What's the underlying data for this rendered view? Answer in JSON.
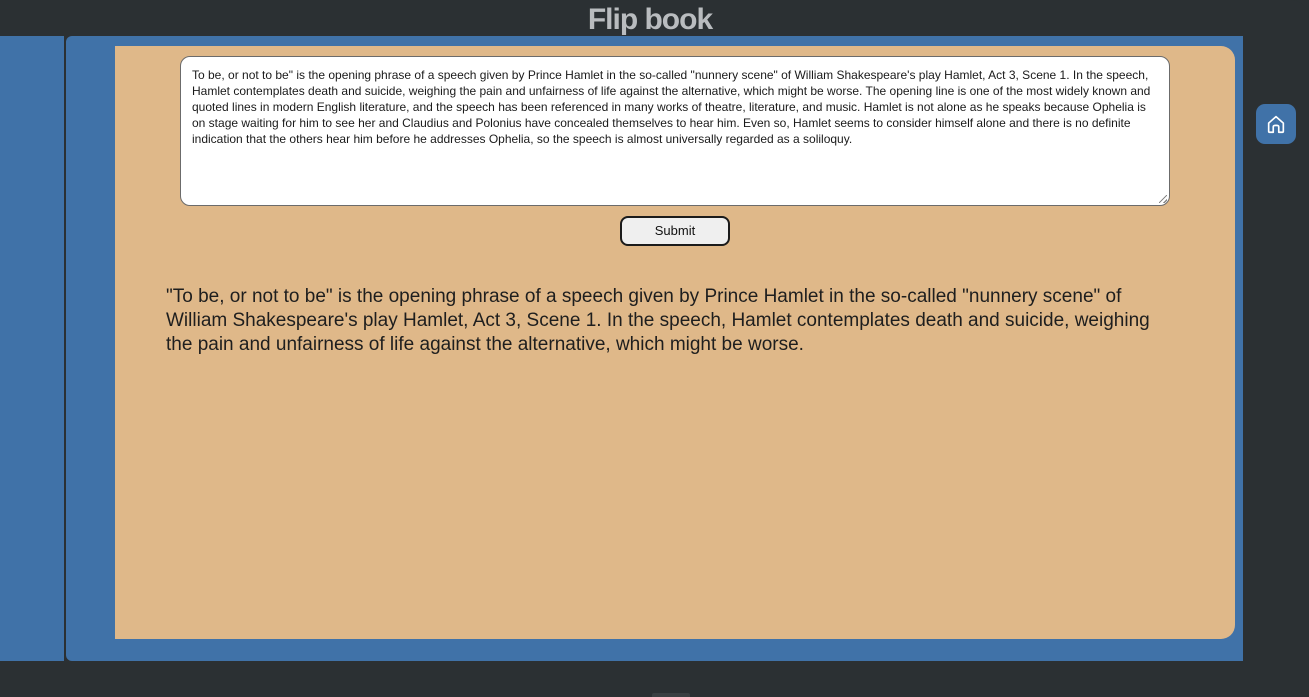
{
  "app": {
    "title": "Flip book"
  },
  "editor": {
    "input_text": "To be, or not to be\" is the opening phrase of a speech given by Prince Hamlet in the so-called \"nunnery scene\" of William Shakespeare's play Hamlet, Act 3, Scene 1. In the speech, Hamlet contemplates death and suicide, weighing the pain and unfairness of life against the alternative, which might be worse. The opening line is one of the most widely known and quoted lines in modern English literature, and the speech has been referenced in many works of theatre, literature, and music. Hamlet is not alone as he speaks because Ophelia is on stage waiting for him to see her and Claudius and Polonius have concealed themselves to hear him. Even so, Hamlet seems to consider himself alone and there is no definite indication that the others hear him before he addresses Ophelia, so the speech is almost universally regarded as a soliloquy.",
    "submit_label": "Submit"
  },
  "output": {
    "text": "\"To be, or not to be\" is the opening phrase of a speech given by Prince Hamlet in the so-called \"nunnery scene\" of William Shakespeare's play Hamlet, Act 3, Scene 1. In the speech, Hamlet contemplates death and suicide, weighing the pain and unfairness of life against the alternative, which might be worse."
  },
  "nav": {
    "home_icon": "home-icon"
  },
  "colors": {
    "frame": "#2b3033",
    "accent_blue": "#4072a8",
    "page": "#dfb889",
    "title": "#b9bcbf"
  }
}
